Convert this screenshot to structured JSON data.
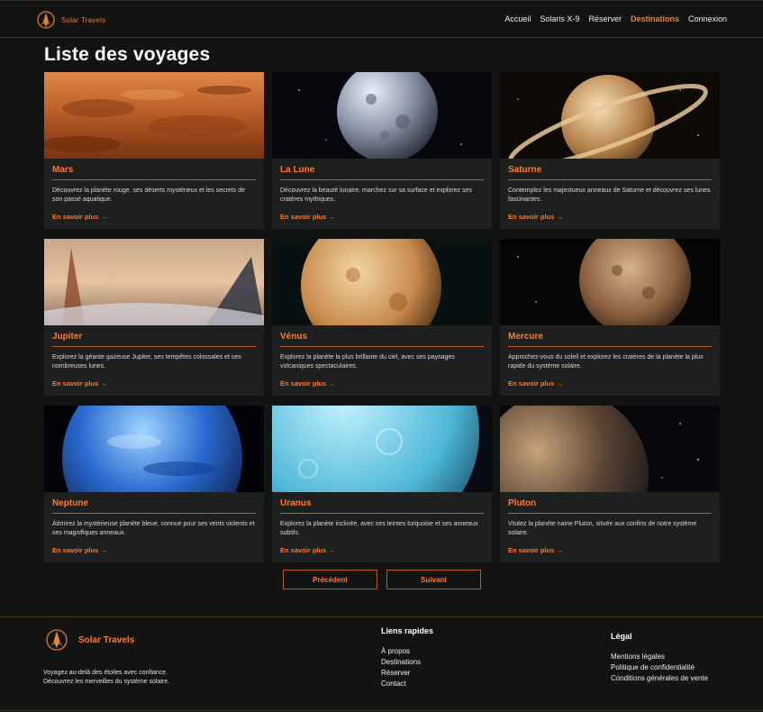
{
  "header": {
    "brand": "Solar Travels",
    "nav": [
      {
        "label": "Accueil",
        "active": false
      },
      {
        "label": "Solaris X-9",
        "active": false
      },
      {
        "label": "Réserver",
        "active": false
      },
      {
        "label": "Destinations",
        "active": true
      },
      {
        "label": "Connexion",
        "active": false
      }
    ]
  },
  "page": {
    "title": "Liste des voyages"
  },
  "cards": [
    {
      "title": "Mars",
      "desc": "Découvrez la planète rouge, ses déserts mystérieux et les secrets de son passé aquatique.",
      "more": "En savoir plus →"
    },
    {
      "title": "La Lune",
      "desc": "Découvrez la beauté lunaire, marchez sur sa surface et explorez ses cratères mythiques.",
      "more": "En savoir plus →"
    },
    {
      "title": "Saturne",
      "desc": "Contemplez les majestueux anneaux de Saturne et découvrez ses lunes fascinantes.",
      "more": "En savoir plus →"
    },
    {
      "title": "Jupiter",
      "desc": "Explorez la géante gazeuse Jupiter, ses tempêtes colossales et ses nombreuses lunes.",
      "more": "En savoir plus →"
    },
    {
      "title": "Vénus",
      "desc": "Explorez la planète la plus brillante du ciel, avec ses paysages volcaniques spectaculaires.",
      "more": "En savoir plus →"
    },
    {
      "title": "Mercure",
      "desc": "Approchez-vous du soleil et explorez les cratères de la planète la plus rapide du système solaire.",
      "more": "En savoir plus →"
    },
    {
      "title": "Neptune",
      "desc": "Admirez la mystérieuse planète bleue, connue pour ses vents violents et ses magnifiques anneaux.",
      "more": "En savoir plus →"
    },
    {
      "title": "Uranus",
      "desc": "Explorez la planète inclinée, avec ses teintes turquoise et ses anneaux subtils.",
      "more": "En savoir plus →"
    },
    {
      "title": "Pluton",
      "desc": "Visitez la planète naine Pluton, située aux confins de notre système solaire.",
      "more": "En savoir plus →"
    }
  ],
  "pagination": {
    "prev": "Précédent",
    "next": "Suivant"
  },
  "footer": {
    "brand": "Solar Travels",
    "tagline_1": "Voyagez au-delà des étoiles avec confiance.",
    "tagline_2": "Découvrez les merveilles du système solaire.",
    "links_title": "Liens rapides",
    "links": [
      "À propos",
      "Destinations",
      "Réserver",
      "Contact"
    ],
    "legal_title": "Légal",
    "legal": [
      "Mentions légales",
      "Politique de confidentialité",
      "Conditions générales de vente"
    ]
  },
  "colors": {
    "accent": "#ff7a2e",
    "background": "#121412",
    "card": "#1d201e"
  }
}
